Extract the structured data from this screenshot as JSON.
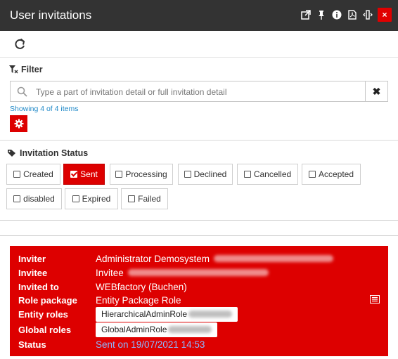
{
  "window": {
    "title": "User invitations",
    "close_label": "×"
  },
  "filter": {
    "label": "Filter",
    "search_placeholder": "Type a part of invitation detail or full invitation detail",
    "clear_label": "✖",
    "showing_text": "Showing 4 of 4 items"
  },
  "status_filter": {
    "label": "Invitation Status",
    "chips": [
      {
        "label": "Created",
        "checked": false
      },
      {
        "label": "Sent",
        "checked": true
      },
      {
        "label": "Processing",
        "checked": false
      },
      {
        "label": "Declined",
        "checked": false
      },
      {
        "label": "Cancelled",
        "checked": false
      },
      {
        "label": "Accepted",
        "checked": false
      },
      {
        "label": "disabled",
        "checked": false
      },
      {
        "label": "Expired",
        "checked": false
      },
      {
        "label": "Failed",
        "checked": false
      }
    ]
  },
  "invitation": {
    "labels": {
      "inviter": "Inviter",
      "invitee": "Invitee",
      "invited_to": "Invited to",
      "role_package": "Role package",
      "entity_roles": "Entity roles",
      "global_roles": "Global roles",
      "status": "Status"
    },
    "inviter": "Administrator Demosystem",
    "invitee": "Invitee",
    "invited_to": "WEBfactory (Buchen)",
    "role_package": "Entity Package Role",
    "entity_role": "HierarchicalAdminRole",
    "global_role": "GlobalAdminRole",
    "status": "Sent on 19/07/2021 14:53"
  },
  "colors": {
    "accent": "#dd0000",
    "titlebar": "#333333",
    "link": "#1e88c7",
    "status_text": "#8bb8ff"
  }
}
